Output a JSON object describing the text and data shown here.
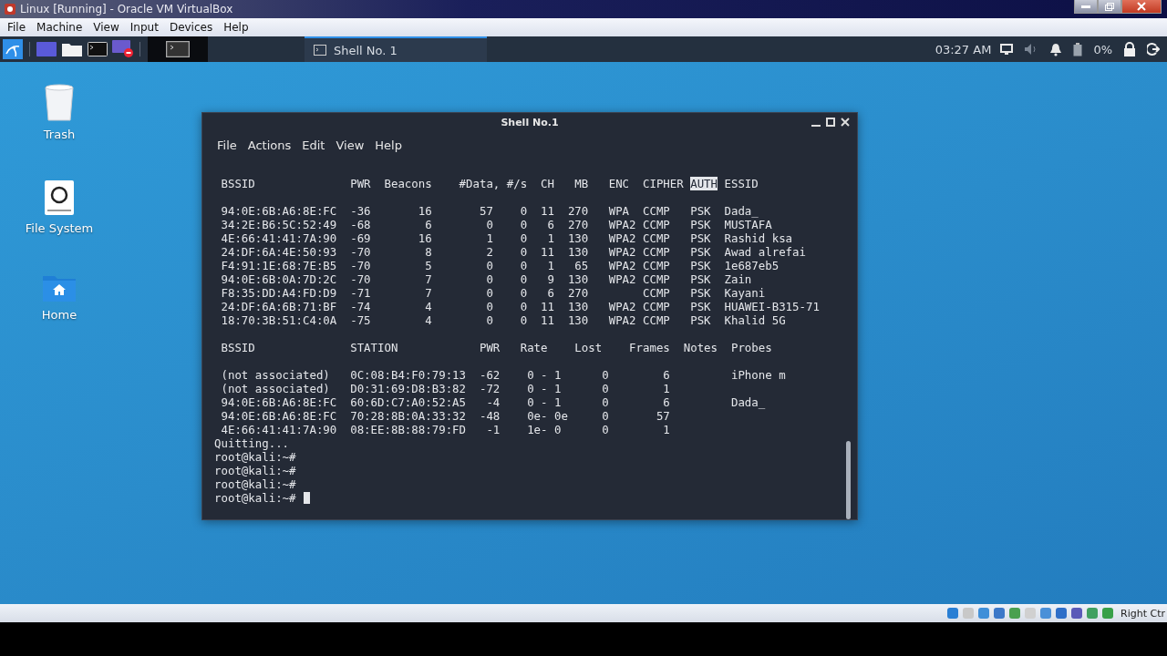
{
  "vbox": {
    "title": "Linux [Running] - Oracle VM VirtualBox",
    "menu": [
      "File",
      "Machine",
      "View",
      "Input",
      "Devices",
      "Help"
    ],
    "host_key": "Right Ctr"
  },
  "panel": {
    "task": {
      "label": "Shell No. 1",
      "selected": true
    },
    "clock": "03:27 AM",
    "battery": "0%"
  },
  "desktop_icons": [
    {
      "label": "Trash",
      "kind": "trash"
    },
    {
      "label": "File System",
      "kind": "drive"
    },
    {
      "label": "Home",
      "kind": "home"
    }
  ],
  "terminal": {
    "title": "Shell No.1",
    "menu": [
      "File",
      "Actions",
      "Edit",
      "View",
      "Help"
    ],
    "lines": [
      {
        "kind": "header",
        "segments": [
          {
            "text": " BSSID              PWR  Beacons    #Data, #/s  CH   MB   ENC  CIPHER ",
            "selected": false
          },
          {
            "text": "AUTH",
            "selected": true
          },
          {
            "text": " ESSID",
            "selected": false
          }
        ]
      },
      {
        "kind": "gap"
      },
      {
        "kind": "plain",
        "text": " 94:0E:6B:A6:8E:FC  -36       16       57    0  11  270   WPA  CCMP   PSK  Dada_"
      },
      {
        "kind": "plain",
        "text": " 34:2E:B6:5C:52:49  -68        6        0    0   6  270   WPA2 CCMP   PSK  MUSTAFA"
      },
      {
        "kind": "plain",
        "text": " 4E:66:41:41:7A:90  -69       16        1    0   1  130   WPA2 CCMP   PSK  Rashid ksa"
      },
      {
        "kind": "plain",
        "text": " 24:DF:6A:4E:50:93  -70        8        2    0  11  130   WPA2 CCMP   PSK  Awad alrefai"
      },
      {
        "kind": "plain",
        "text": " F4:91:1E:68:7E:B5  -70        5        0    0   1   65   WPA2 CCMP   PSK  1e687eb5"
      },
      {
        "kind": "plain",
        "text": " 94:0E:6B:0A:7D:2C  -70        7        0    0   9  130   WPA2 CCMP   PSK  Zain"
      },
      {
        "kind": "plain",
        "text": " F8:35:DD:A4:FD:D9  -71        7        0    0   6  270        CCMP   PSK  Kayani"
      },
      {
        "kind": "plain",
        "text": " 24:DF:6A:6B:71:BF  -74        4        0    0  11  130   WPA2 CCMP   PSK  HUAWEI-B315-71"
      },
      {
        "kind": "plain",
        "text": " 18:70:3B:51:C4:0A  -75        4        0    0  11  130   WPA2 CCMP   PSK  Khalid 5G"
      },
      {
        "kind": "gap"
      },
      {
        "kind": "plain",
        "text": " BSSID              STATION            PWR   Rate    Lost    Frames  Notes  Probes"
      },
      {
        "kind": "gap"
      },
      {
        "kind": "plain",
        "text": " (not associated)   0C:08:B4:F0:79:13  -62    0 - 1      0        6         iPhone m"
      },
      {
        "kind": "plain",
        "text": " (not associated)   D0:31:69:D8:B3:82  -72    0 - 1      0        1"
      },
      {
        "kind": "plain",
        "text": " 94:0E:6B:A6:8E:FC  60:6D:C7:A0:52:A5   -4    0 - 1      0        6         Dada_"
      },
      {
        "kind": "plain",
        "text": " 94:0E:6B:A6:8E:FC  70:28:8B:0A:33:32  -48    0e- 0e     0       57"
      },
      {
        "kind": "plain",
        "text": " 4E:66:41:41:7A:90  08:EE:8B:88:79:FD   -1    1e- 0      0        1"
      },
      {
        "kind": "plain",
        "text": "Quitting..."
      },
      {
        "kind": "plain",
        "text": "root@kali:~#"
      },
      {
        "kind": "plain",
        "text": "root@kali:~#"
      },
      {
        "kind": "plain",
        "text": "root@kali:~#"
      },
      {
        "kind": "prompt",
        "text": "root@kali:~#"
      }
    ]
  }
}
